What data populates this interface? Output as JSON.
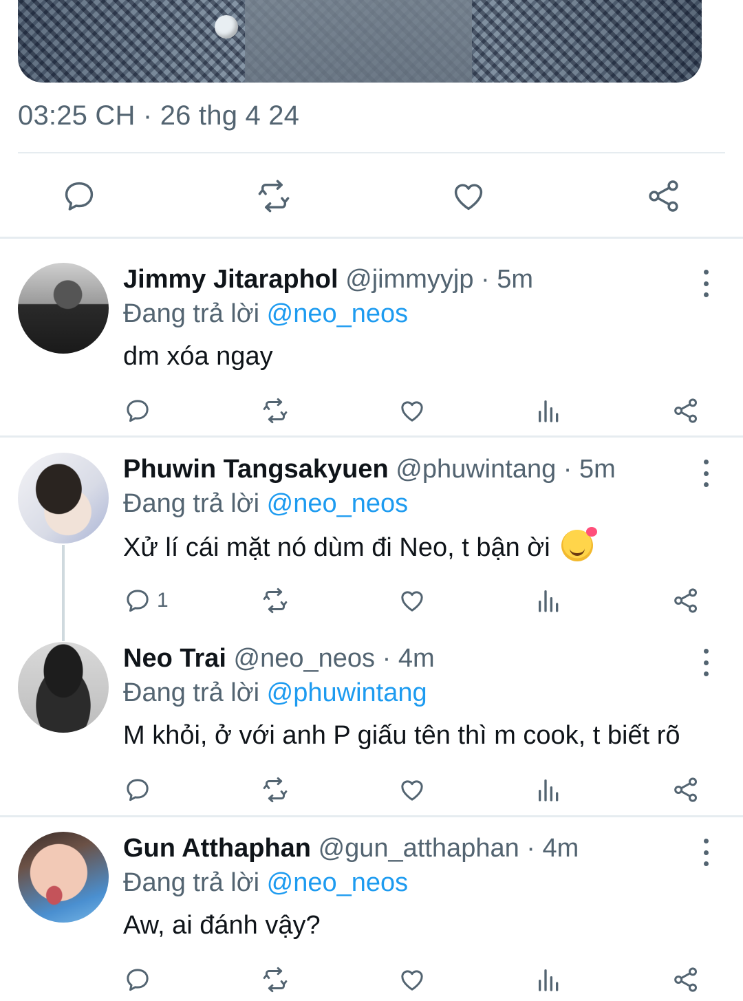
{
  "tweet": {
    "timestamp": "03:25 CH · 26 thg 4 24",
    "actions": {
      "reply_icon": "comment-icon",
      "retweet_icon": "retweet-icon",
      "like_icon": "heart-icon",
      "share_icon": "share-icon"
    }
  },
  "colors": {
    "text_primary": "#0f1419",
    "text_secondary": "#536471",
    "link": "#1d9bf0",
    "divider": "#e6ecf0"
  },
  "replies": [
    {
      "name": "Jimmy Jitaraphol",
      "handle": "@jimmyyjp",
      "separator": "·",
      "time": "5m",
      "replying_prefix": "Đang trả lời",
      "replying_to": "@neo_neos",
      "text": "dm xóa ngay",
      "reply_count": ""
    },
    {
      "name": "Phuwin Tangsakyuen",
      "handle": "@phuwintang",
      "separator": "·",
      "time": "5m",
      "replying_prefix": "Đang trả lời",
      "replying_to": "@neo_neos",
      "text": "Xử lí cái mặt nó dùm đi Neo, t bận ời",
      "emoji": "smiling-face-with-hearts",
      "reply_count": "1"
    },
    {
      "name": "Neo Trai",
      "handle": "@neo_neos",
      "separator": "·",
      "time": "4m",
      "replying_prefix": "Đang trả lời",
      "replying_to": "@phuwintang",
      "text": "M khỏi, ở với anh P giấu tên thì m cook, t biết rõ",
      "reply_count": ""
    },
    {
      "name": "Gun Atthaphan",
      "handle": "@gun_atthaphan",
      "separator": "·",
      "time": "4m",
      "replying_prefix": "Đang trả lời",
      "replying_to": "@neo_neos",
      "text": "Aw, ai đánh vậy?",
      "reply_count": ""
    }
  ]
}
